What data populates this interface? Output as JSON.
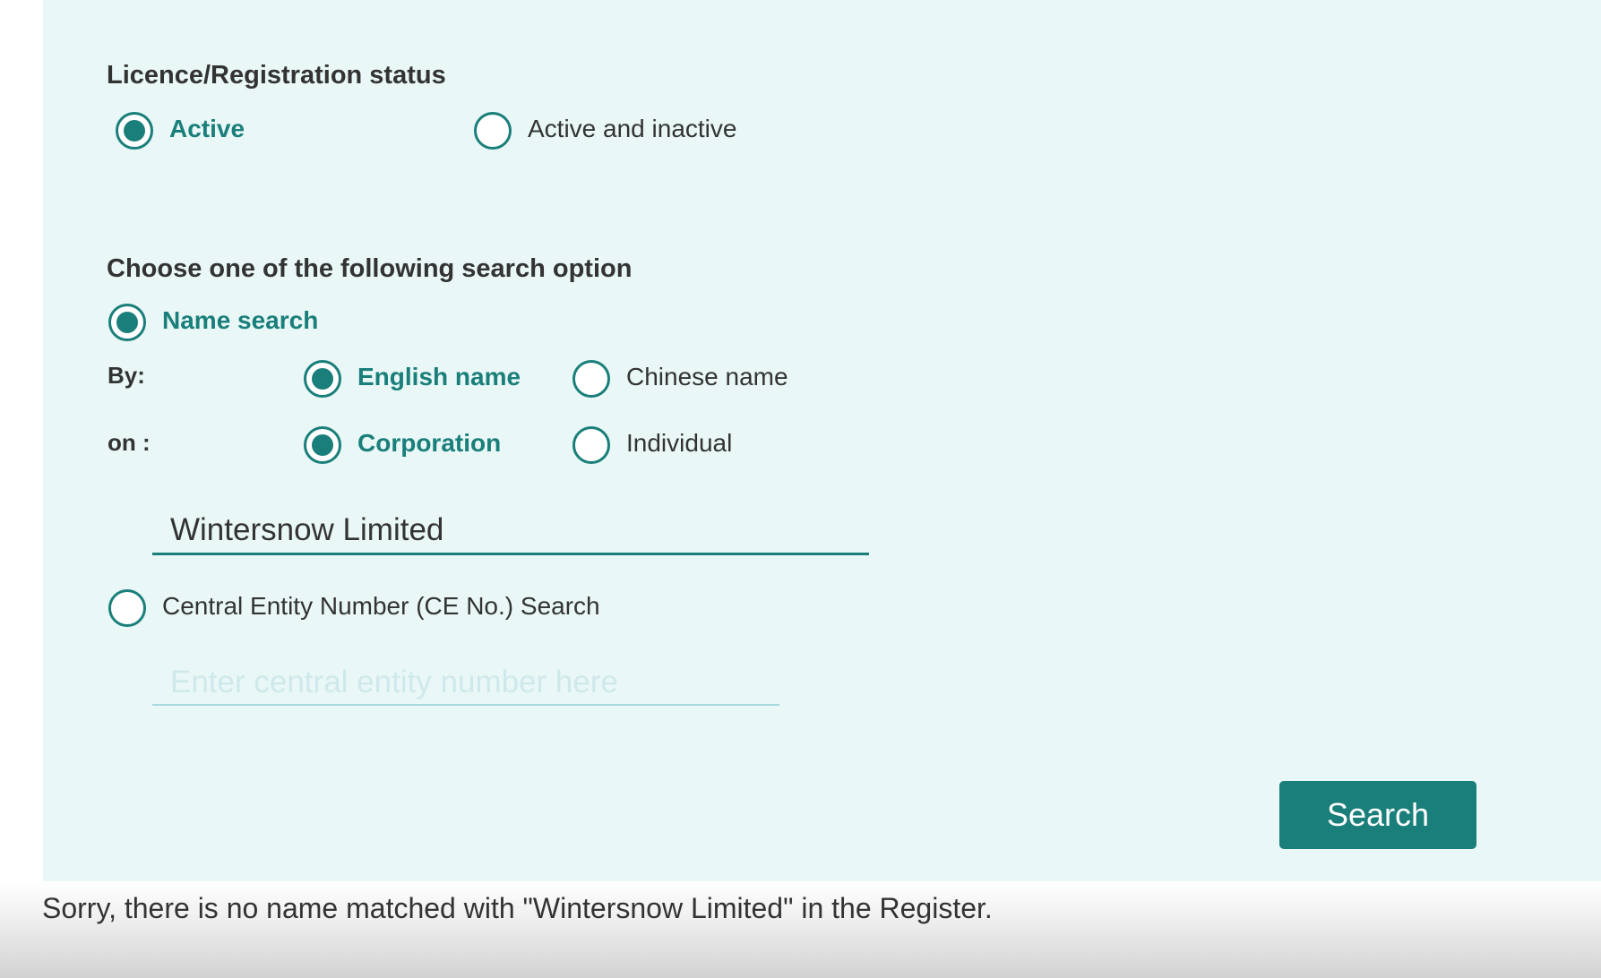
{
  "status": {
    "heading": "Licence/Registration status",
    "options": [
      {
        "label": "Active",
        "selected": true
      },
      {
        "label": "Active and inactive",
        "selected": false
      }
    ]
  },
  "search_option": {
    "heading": "Choose one of the following search option",
    "name_search": {
      "label": "Name search",
      "selected": true
    },
    "by": {
      "label": "By:",
      "options": [
        {
          "label": "English name",
          "selected": true
        },
        {
          "label": "Chinese name",
          "selected": false
        }
      ]
    },
    "on": {
      "label": "on :",
      "options": [
        {
          "label": "Corporation",
          "selected": true
        },
        {
          "label": "Individual",
          "selected": false
        }
      ]
    },
    "name_input": {
      "value": "Wintersnow Limited"
    },
    "ce_search": {
      "label": "Central Entity Number (CE No.) Search",
      "selected": false
    },
    "ce_input": {
      "value": "",
      "placeholder": "Enter central entity number here"
    }
  },
  "search_button": {
    "label": "Search"
  },
  "result": {
    "message": "Sorry, there is no name matched with \"Wintersnow Limited\" in the Register."
  },
  "colors": {
    "accent": "#1a7f7a",
    "panel_background": "#e9f7f7",
    "text": "#333333"
  }
}
